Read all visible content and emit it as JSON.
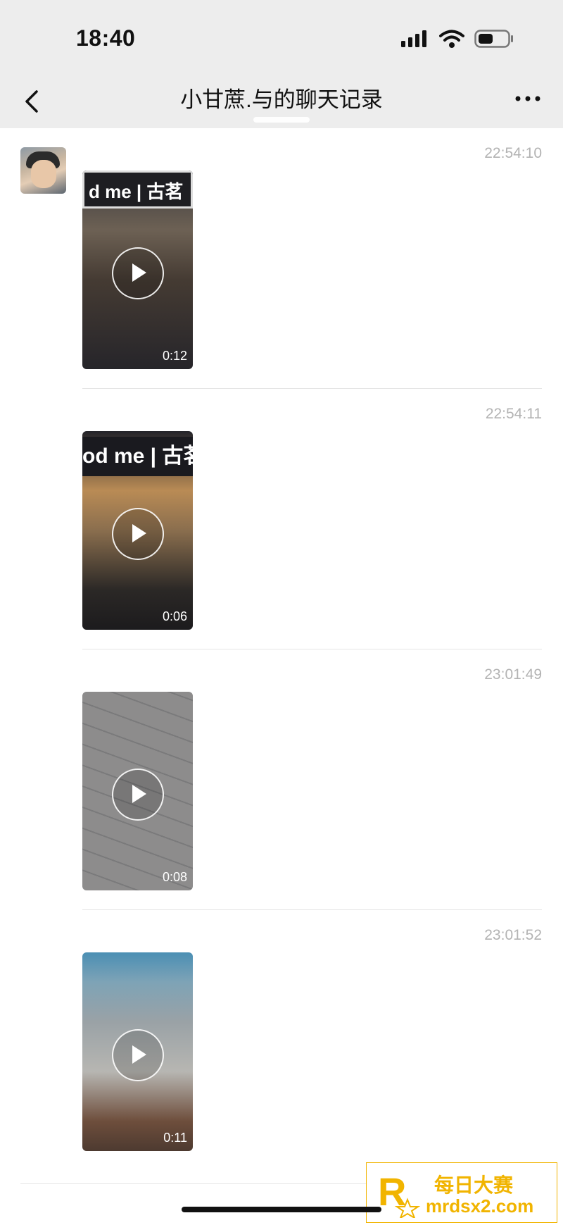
{
  "status_bar": {
    "time": "18:40"
  },
  "nav": {
    "title": "小甘蔗.与的聊天记录"
  },
  "messages": [
    {
      "timestamp": "22:54:10",
      "duration": "0:12",
      "sign_text": "d me | 古茗"
    },
    {
      "timestamp": "22:54:11",
      "duration": "0:06",
      "sign_text": "od me | 古茗"
    },
    {
      "timestamp": "23:01:49",
      "duration": "0:08"
    },
    {
      "timestamp": "23:01:52",
      "duration": "0:11"
    }
  ],
  "watermark": {
    "line1": "每日大赛",
    "line2": "mrdsx2.com",
    "accent": "#f1b400"
  }
}
